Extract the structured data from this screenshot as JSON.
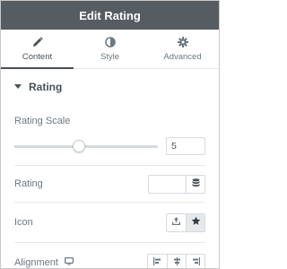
{
  "header": {
    "title": "Edit Rating"
  },
  "tabs": [
    {
      "label": "Content",
      "icon": "pencil-icon",
      "active": true
    },
    {
      "label": "Style",
      "icon": "half-circle-icon",
      "active": false
    },
    {
      "label": "Advanced",
      "icon": "gear-icon",
      "active": false
    }
  ],
  "section": {
    "title": "Rating"
  },
  "rating_scale": {
    "label": "Rating Scale",
    "value": "5",
    "slider_fraction": 0.45
  },
  "rating": {
    "label": "Rating",
    "value": ""
  },
  "icon_control": {
    "label": "Icon",
    "options": [
      "upload-icon",
      "star-icon"
    ],
    "selected": "star-icon"
  },
  "alignment": {
    "label": "Alignment",
    "options": [
      "align-left-icon",
      "align-center-icon",
      "align-right-icon"
    ]
  },
  "colors": {
    "header_bg": "#555c62",
    "active_tab_underline": "#4a4f54",
    "border": "#d5dadf"
  }
}
